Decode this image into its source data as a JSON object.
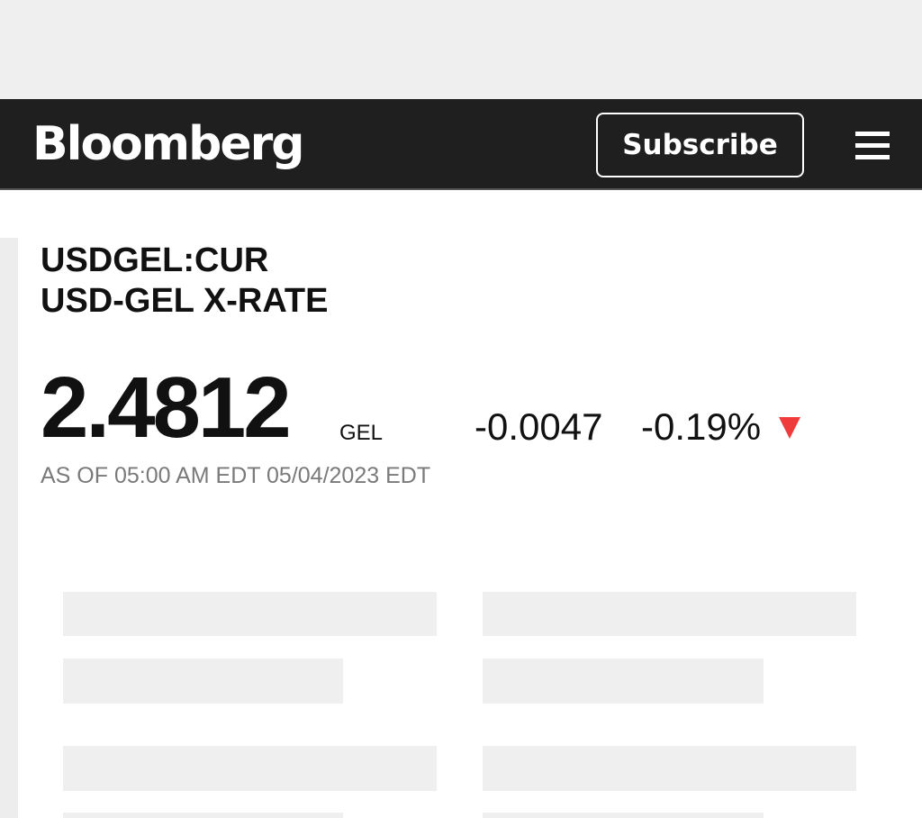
{
  "header": {
    "logo": "Bloomberg",
    "subscribe_label": "Subscribe",
    "menu_icon": "hamburger-menu-icon"
  },
  "quote": {
    "ticker": "USDGEL:CUR",
    "name": "USD-GEL X-RATE",
    "price": "2.4812",
    "currency": "GEL",
    "change": "-0.0047",
    "change_percent": "-0.19%",
    "direction_icon": "down-triangle-icon",
    "direction_color": "#ef3b3b",
    "timestamp": "AS OF 05:00 AM EDT 05/04/2023 EDT"
  },
  "colors": {
    "navbar_bg": "#1f1f1f",
    "page_bg": "#ffffff",
    "placeholder": "#efefef"
  }
}
